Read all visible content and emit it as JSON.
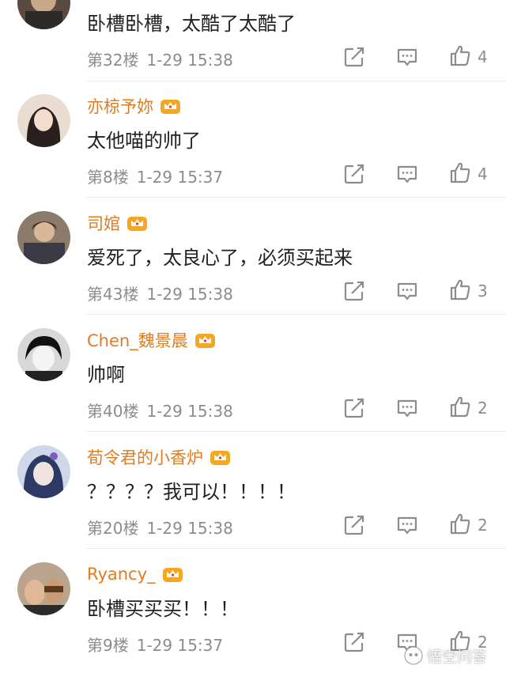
{
  "comments": [
    {
      "name": "",
      "text": "卧槽卧槽，太酷了太酷了",
      "floor": "第32楼",
      "time": "1-29 15:38",
      "likes": "4"
    },
    {
      "name": "亦椋予妳",
      "text": "太他喵的帅了",
      "floor": "第8楼",
      "time": "1-29 15:37",
      "likes": "4"
    },
    {
      "name": "司婠",
      "text": "爱死了，太良心了，必须买起来",
      "floor": "第43楼",
      "time": "1-29 15:38",
      "likes": "3"
    },
    {
      "name": "Chen_魏景晨",
      "text": "帅啊",
      "floor": "第40楼",
      "time": "1-29 15:38",
      "likes": "2"
    },
    {
      "name": "荀令君的小香炉",
      "text": "？？？？我可以！！！！",
      "floor": "第20楼",
      "time": "1-29 15:38",
      "likes": "2"
    },
    {
      "name": "Ryancy_",
      "text": "卧槽买买买！！！",
      "floor": "第9楼",
      "time": "1-29 15:37",
      "likes": "2"
    }
  ],
  "watermark": {
    "text": "悟空问答"
  },
  "colors": {
    "username": "#e07b1f",
    "meta": "#8c8c8c",
    "text": "#222222",
    "crown": "#f5a623"
  }
}
